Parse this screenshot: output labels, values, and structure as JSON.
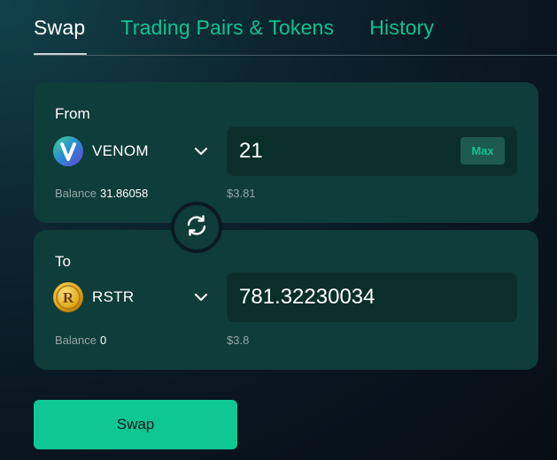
{
  "tabs": [
    {
      "label": "Swap",
      "active": true
    },
    {
      "label": "Trading Pairs & Tokens",
      "active": false
    },
    {
      "label": "History",
      "active": false
    }
  ],
  "from": {
    "label": "From",
    "token": {
      "symbol": "VENOM",
      "icon": "venom-logo-icon"
    },
    "amount": "21",
    "max_label": "Max",
    "balance_label": "Balance",
    "balance_value": "31.86058",
    "usd_value": "$3.81"
  },
  "to": {
    "label": "To",
    "token": {
      "symbol": "RSTR",
      "icon": "rstr-coin-icon"
    },
    "amount": "781.32230034",
    "balance_label": "Balance",
    "balance_value": "0",
    "usd_value": "$3.8"
  },
  "swap_button_label": "Swap",
  "colors": {
    "accent": "#11c28f",
    "card": "#0f3d39",
    "input_bg": "#0a2f2b",
    "button": "#0fc792"
  }
}
